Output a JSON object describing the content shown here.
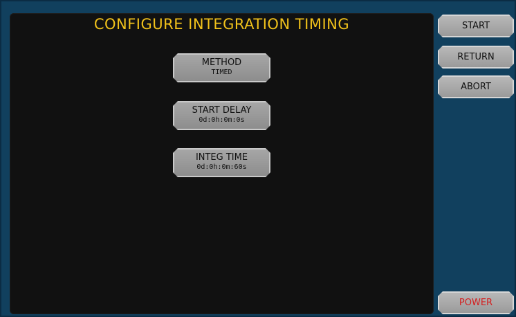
{
  "title": "CONFIGURE INTEGRATION TIMING",
  "params": [
    {
      "label": "METHOD",
      "value": "TIMED"
    },
    {
      "label": "START DELAY",
      "value": "0d:0h:0m:0s"
    },
    {
      "label": "INTEG TIME",
      "value": "0d:0h:0m:60s"
    }
  ],
  "side_buttons": {
    "start": "START",
    "return": "RETURN",
    "abort": "ABORT",
    "power": "POWER"
  },
  "colors": {
    "title": "#f1c21b",
    "frame": "#11405e",
    "panel": "#111111",
    "power_text": "#d41e1e"
  }
}
